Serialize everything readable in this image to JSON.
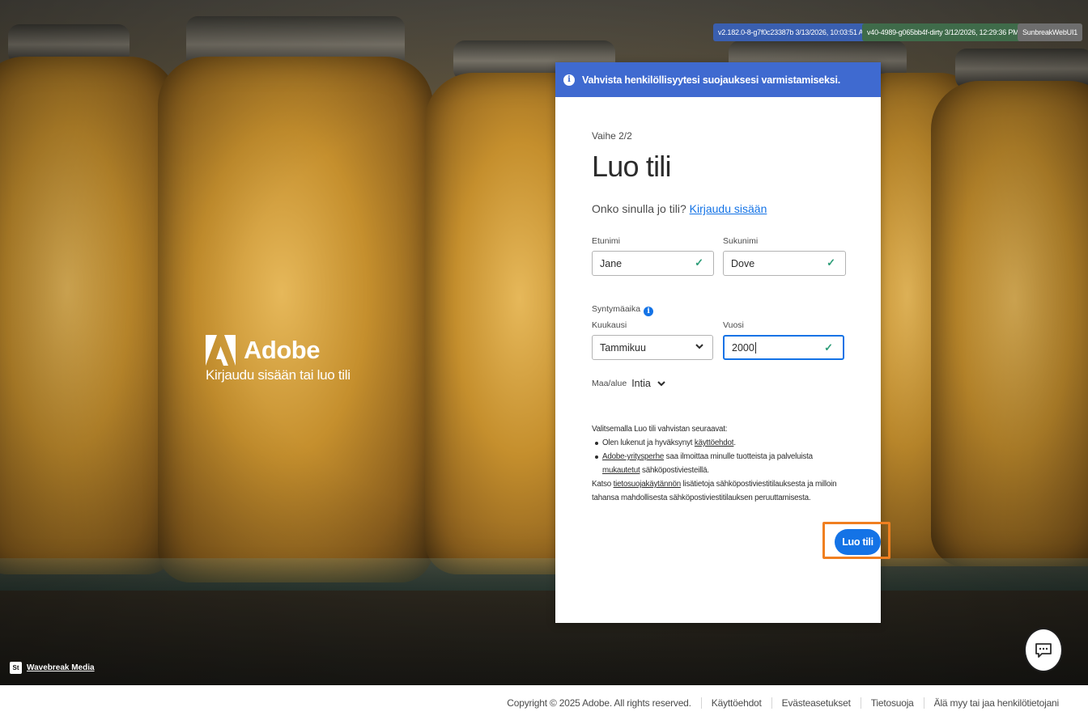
{
  "badges": [
    {
      "text": "v2.182.0-8-g7f0c23387b 3/13/2026, 10:03:51 AM",
      "color": "#3a5fb0"
    },
    {
      "text": "v40-4989-g065bb4f-dirty 3/12/2026, 12:29:36 PM",
      "color": "#3f6b4a"
    },
    {
      "text": "SunbreakWebUI1",
      "color": "#6e6e6e"
    }
  ],
  "brand": {
    "name": "Adobe",
    "tagline": "Kirjaudu sisään tai luo tili"
  },
  "banner": {
    "icon": "info-icon",
    "text": "Vahvista henkilöllisyytesi suojauksesi varmistamiseksi."
  },
  "form": {
    "step": "Vaihe 2/2",
    "title": "Luo tili",
    "have_account_text": "Onko sinulla jo tili?",
    "sign_in_link": "Kirjaudu sisään",
    "first_name": {
      "label": "Etunimi",
      "value": "Jane"
    },
    "last_name": {
      "label": "Sukunimi",
      "value": "Dove"
    },
    "birthdate_label": "Syntymäaika",
    "month": {
      "label": "Kuukausi",
      "value": "Tammikuu"
    },
    "year": {
      "label": "Vuosi",
      "value": "2000"
    },
    "region": {
      "label": "Maa/alue",
      "value": "Intia"
    },
    "legal": {
      "intro": "Valitsemalla Luo tili vahvistan seuraavat:",
      "item1_pre": "Olen lukenut ja hyväksynyt",
      "item1_link": "käyttöehdot",
      "item1_post": ".",
      "item2_link": "Adobe-yritysperhe",
      "item2_mid": "saa ilmoittaa minulle tuotteista ja palveluista",
      "item2_link2": "mukautetut",
      "item2_post": "sähköpostiviesteillä.",
      "privacy_pre": "Katso",
      "privacy_link": "tietosuojakäytännön",
      "privacy_post": "lisätietoja sähköpostiviestitilauksesta ja milloin tahansa mahdollisesta sähköpostiviestitilauksen peruuttamisesta."
    },
    "submit_label": "Luo tili"
  },
  "credit": {
    "logo": "St",
    "text": "Wavebreak Media"
  },
  "chat": {
    "icon": "chat-icon"
  },
  "footer": {
    "items": [
      "Copyright © 2025 Adobe. All rights reserved.",
      "Käyttöehdot",
      "Evästeasetukset",
      "Tietosuoja",
      "Älä myy tai jaa henkilötietojani"
    ]
  }
}
